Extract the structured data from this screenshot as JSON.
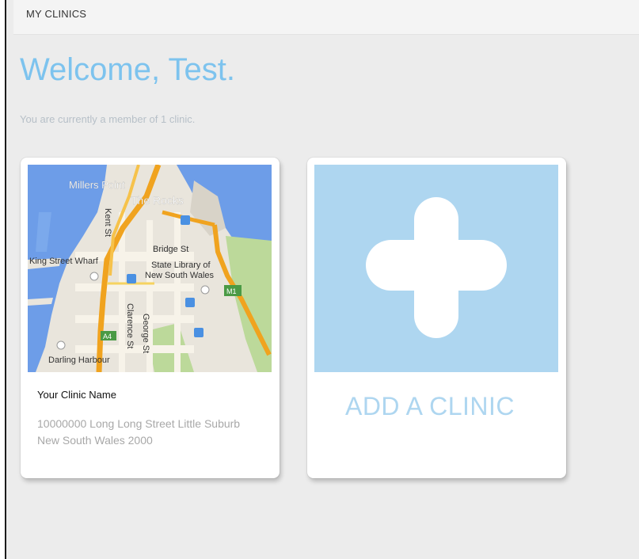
{
  "header": {
    "section_label": "MY CLINICS"
  },
  "welcome": {
    "heading": "Welcome, Test.",
    "membership_text": "You are currently a member of 1 clinic."
  },
  "clinics": [
    {
      "name": "Your Clinic Name",
      "address": "10000000 Long Long Street Little Suburb New South Wales 2000",
      "map_labels": {
        "millers_point": "Millers Point",
        "the_rocks": "The Rocks",
        "kent_st": "Kent St",
        "bridge_st": "Bridge St",
        "state_library_1": "State Library of",
        "state_library_2": "New South Wales",
        "king_street_wharf": "King Street Wharf",
        "clarence_st": "Clarence St",
        "george_st": "George St",
        "darling_harbour": "Darling Harbour",
        "m1": "M1",
        "a4": "A4"
      }
    }
  ],
  "add_clinic": {
    "label": "ADD A CLINIC"
  },
  "colors": {
    "accent": "#7dc3ee",
    "add_tile": "#aed6f0",
    "background": "#ececec"
  }
}
